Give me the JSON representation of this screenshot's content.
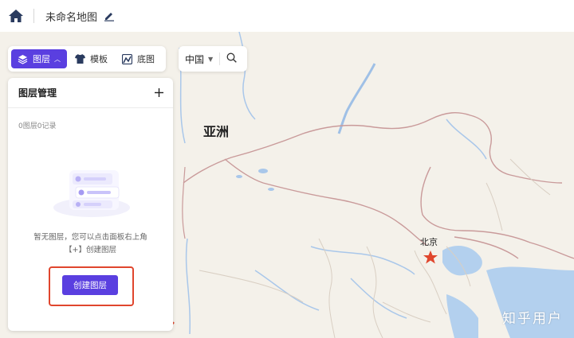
{
  "topbar": {
    "home_icon": "home-icon",
    "title": "未命名地图",
    "edit_icon": "edit-icon"
  },
  "toolbar": {
    "layers_label": "图层",
    "templates_label": "模板",
    "basemap_label": "底图"
  },
  "region": {
    "selected": "中国",
    "search_icon": "search-icon"
  },
  "panel": {
    "title": "图层管理",
    "count_text": "0图层0记录",
    "empty_line1": "暂无图层，您可以点击面板右上角",
    "empty_line2": "【+】创建图层",
    "create_label": "创建图层"
  },
  "map": {
    "continent_label": "亚洲",
    "city_label": "北京"
  },
  "watermark": "知乎用户",
  "colors": {
    "accent": "#5a3fe0",
    "highlight": "#e0462d"
  }
}
